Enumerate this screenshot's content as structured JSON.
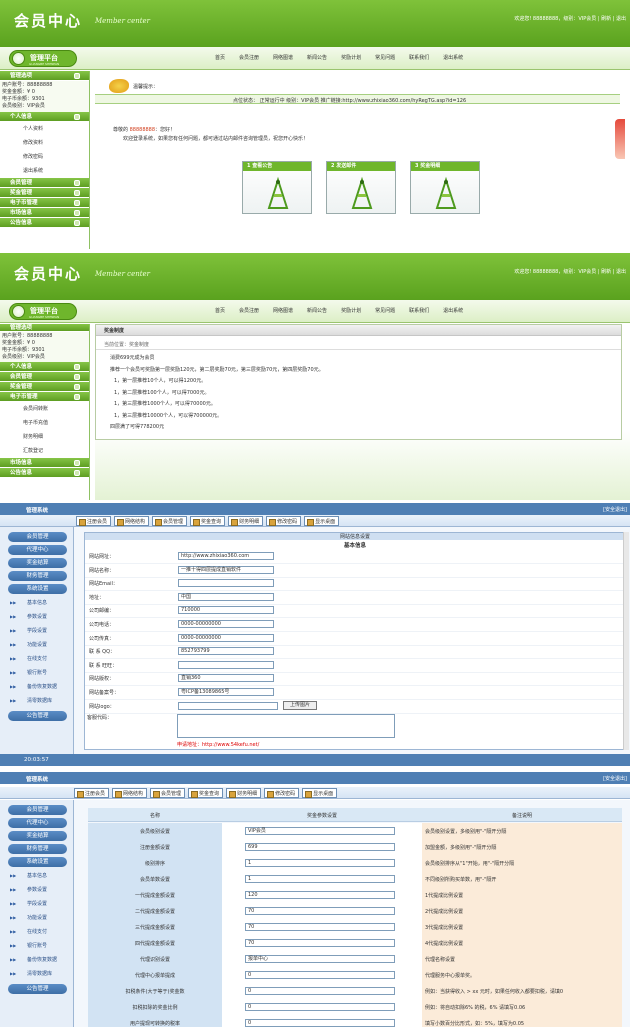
{
  "member": {
    "title": "会员中心",
    "subtitle": "Member center",
    "welcome": "欢迎您! 88888888，级别：VIP会员 | 刷新 | 退出",
    "logo_text": "管理平台",
    "logo_sub": "GUANGBE SHENPAN",
    "nav": [
      "首页",
      "会员注册",
      "网络图谱",
      "新闻公告",
      "奖励计划",
      "常见问题",
      "联系我们",
      "退出系统"
    ],
    "info": {
      "title": "管理选项",
      "account": "用户账号：88888888",
      "bonus": "奖金金额：¥ 0",
      "ecash": "电子币余额：9301",
      "level": "会员级别：VIP会员"
    },
    "personal": {
      "title": "个人信息",
      "items": [
        "个人资料",
        "修改资料",
        "修改密码",
        "退出系统"
      ]
    },
    "menus_a": [
      "会员管理",
      "奖金管理",
      "电子币管理",
      "市场信息",
      "公告信息"
    ],
    "notice_title": "温馨提示：",
    "status_bar": "点位状态：  正常运行中   级别：VIP会员   推广链接:http://www.zhixiao360.com/hyRegTG.asp?id=126",
    "greeting_pre": "尊敬的 ",
    "user_id": "88888888",
    "greeting_post": "：您好！",
    "greeting_line": "欢迎登录系统，如果您有任何问题，都可通过站内邮件咨询管理员，祝您开心快乐！",
    "cards": [
      "查看公告",
      "发送邮件",
      "奖金明细"
    ],
    "panel2_title": "奖金制度",
    "panel2_loc": "当前位置：奖金制度",
    "panel2_lines": [
      "消费699元成为会员",
      "推荐一个会员可奖励第一层奖励120元，第二层奖励70元，第三层奖励70元，第四层奖励70元。",
      "1，第一层推荐10个人，可以得1200元。",
      "1，第二层推荐100个人，可以得7000元。",
      "1，第三层推荐1000个人，可以得70000元。",
      "1，第三层推荐10000个人，可以得700000元。",
      "四层满了可得778200元"
    ],
    "menus_b": [
      "个人信息",
      "会员管理",
      "奖金管理"
    ],
    "ecash_title": "电子币管理",
    "ecash_items": [
      "会员间转账",
      "电子币充值",
      "财务明细",
      "汇款登记"
    ],
    "menus_c": [
      "市场信息",
      "公告信息"
    ]
  },
  "admin": {
    "title": "管理系统",
    "logout": "[安全退出]",
    "toolbar": [
      "注册会员",
      "网络结构",
      "会员管理",
      "奖金查询",
      "财务明细",
      "修改密码",
      "显示桌面"
    ],
    "groups": [
      "会员管理",
      "代理中心",
      "奖金结算",
      "财务管理",
      "系统设置"
    ],
    "sys_items": [
      "基本信息",
      "参数设置",
      "学段设置",
      "功能设置",
      "在线支付",
      "银行账号",
      "备份恢复数据",
      "清零数据库"
    ],
    "bottom_group": "公告管理",
    "time": "20:03:57",
    "form_header": "网站信息设置",
    "form_sub": "基本信息",
    "fields": [
      {
        "label": "网站网址：",
        "value": "http://www.zhixiao360.com"
      },
      {
        "label": "网站名称：",
        "value": "一推十得四层提成直销软件"
      },
      {
        "label": "网站Email：",
        "value": ""
      },
      {
        "label": "地址：",
        "value": "中国"
      },
      {
        "label": "公司邮编：",
        "value": "710000"
      },
      {
        "label": "公司电话：",
        "value": "0000-00000000"
      },
      {
        "label": "公司传真：",
        "value": "0000-00000000"
      },
      {
        "label": "联 系 QQ：",
        "value": "852793799"
      },
      {
        "label": "联 系 旺旺：",
        "value": ""
      },
      {
        "label": "网站版权：",
        "value": "直销360"
      },
      {
        "label": "网站备案号：",
        "value": "粤ICP备13089865号"
      },
      {
        "label": "网站logo：",
        "value": ""
      }
    ],
    "upload": "上传图片",
    "kefu_label": "客服代码：",
    "kefu_note": "申请地址：http://www.54kefu.net/",
    "param_headers": [
      "名称",
      "奖金参数设置",
      "备注说明"
    ],
    "params": [
      {
        "name": "会员级别设置",
        "value": "VIP会员",
        "note": "会员级别设置，多级别用\"-\"隔开分隔"
      },
      {
        "name": "注册金额设置",
        "value": "699",
        "note": "加盟金额，多级别用\"-\"隔开分隔"
      },
      {
        "name": "级别排序",
        "value": "1",
        "note": "会员级别排序从\"1\"开始，用\"-\"隔开分隔"
      },
      {
        "name": "会员单数设置",
        "value": "1",
        "note": "不同级别所购买单数，用\"-\"隔开"
      },
      {
        "name": "一代提成金额设置",
        "value": "120",
        "note": "1代提成比例设置"
      },
      {
        "name": "二代提成金额设置",
        "value": "70",
        "note": "2代提成比例设置"
      },
      {
        "name": "三代提成金额设置",
        "value": "70",
        "note": "3代提成比例设置"
      },
      {
        "name": "四代提成金额设置",
        "value": "70",
        "note": "4代提成比例设置"
      },
      {
        "name": "代理识别设置",
        "value": "报单中心",
        "note": "代理名称设置"
      },
      {
        "name": "代理中心报单提成",
        "value": "0",
        "note": "代理服务中心报单奖。"
      },
      {
        "name": "扣税条件(大于等于)奖金数",
        "value": "0",
        "note": "例如：当获得收入 > xx 元时，如果任何收入都要扣税，请填0"
      },
      {
        "name": "扣税扣除的奖金比例",
        "value": "0",
        "note": "例如：将自动扣除6% 的税，6% 请填写0.06"
      },
      {
        "name": "用户提现可转换的税率",
        "value": "0",
        "note": "填写小数百分比形式，如：5%，填写为0.05"
      }
    ]
  }
}
